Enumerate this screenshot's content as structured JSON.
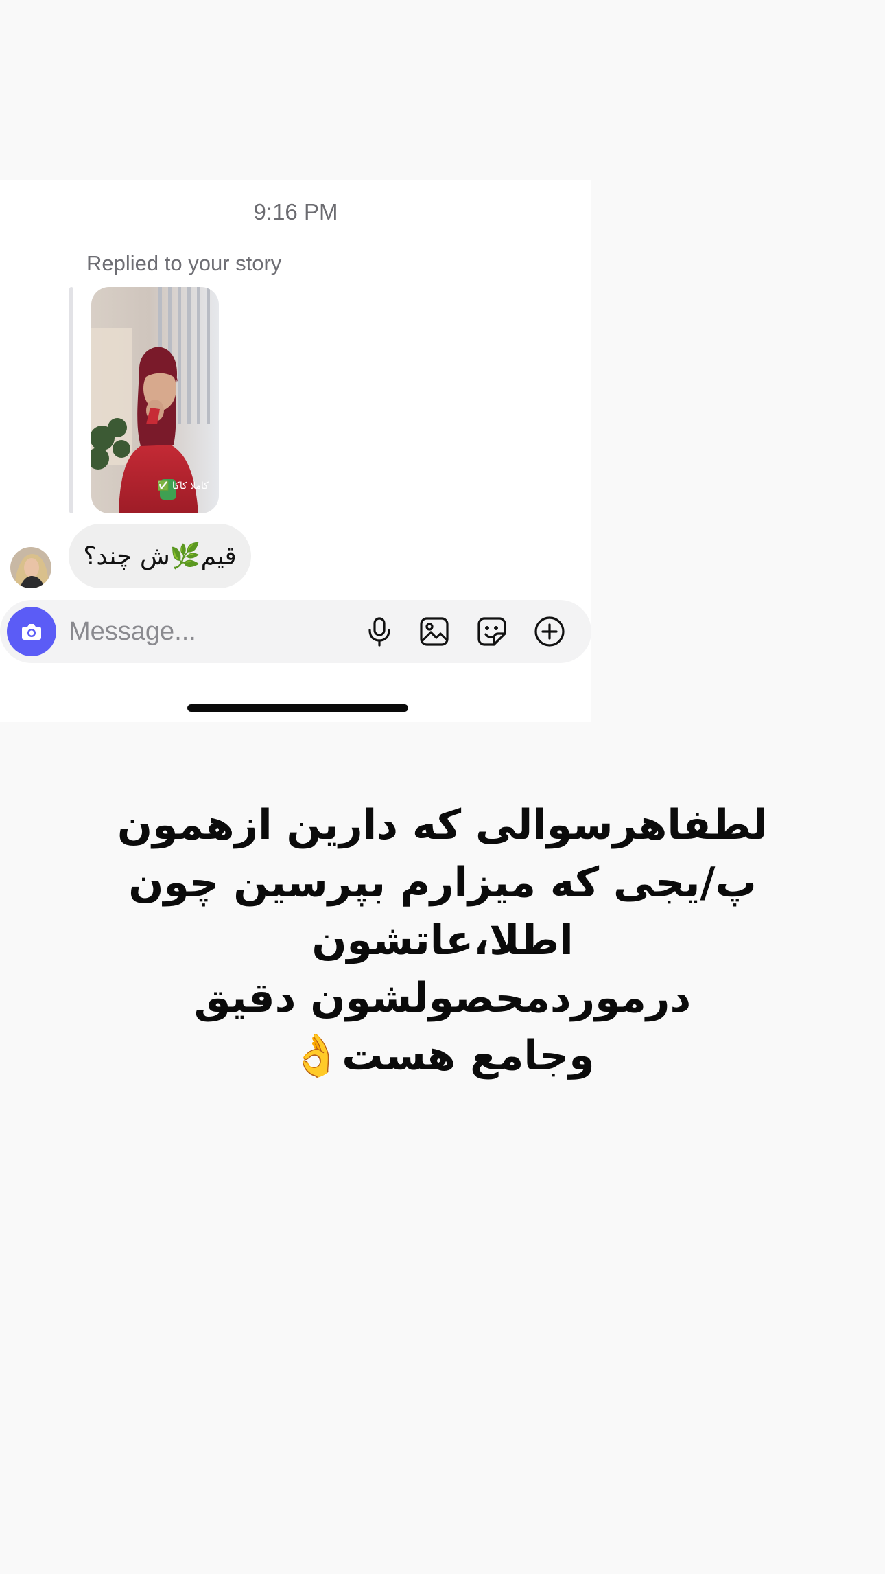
{
  "chat": {
    "timestamp": "9:16 PM",
    "replied_label": "Replied to your story",
    "story_caption": "کاملا کاکا ✅",
    "message_text": "قیم🌿ش چند؟"
  },
  "composer": {
    "placeholder": "Message...",
    "icons": [
      "camera-icon",
      "microphone-icon",
      "gallery-icon",
      "sticker-icon",
      "add-icon"
    ],
    "accent_color": "#5b5cf6"
  },
  "overlay_caption": {
    "lines": [
      "لطفاهرسوالی که دارین ازهمون",
      "پ/یجی که میزارم بپرسین چون",
      "اطلا،عاتشون",
      "درموردمحصولشون دقیق",
      "وجامع هست👌"
    ]
  }
}
